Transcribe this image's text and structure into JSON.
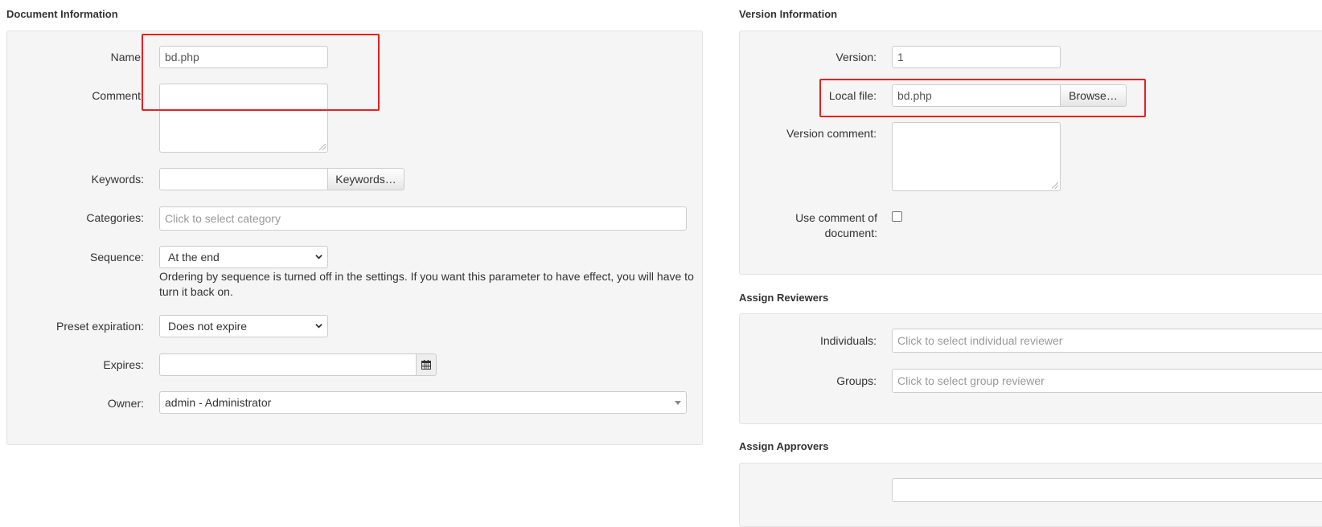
{
  "document_info": {
    "title": "Document Information",
    "name_label": "Name",
    "name_value": "bd.php",
    "comment_label": "Comment",
    "keywords_label": "Keywords:",
    "keywords_button": "Keywords…",
    "categories_label": "Categories:",
    "categories_placeholder": "Click to select category",
    "sequence_label": "Sequence:",
    "sequence_value": "At the end",
    "sequence_help_line1": "Ordering by sequence is turned off in the settings. If you want this parameter to have effect, you will have to",
    "sequence_help_line2": "turn it back on.",
    "preset_label": "Preset expiration:",
    "preset_value": "Does not expire",
    "expires_label": "Expires:",
    "owner_label": "Owner:",
    "owner_value": "admin - Administrator"
  },
  "version_info": {
    "title": "Version Information",
    "version_label": "Version:",
    "version_value": "1",
    "local_file_label": "Local file:",
    "local_file_value": "bd.php",
    "browse_button": "Browse…",
    "version_comment_label": "Version comment:",
    "use_comment_label_line1": "Use comment of",
    "use_comment_label_line2": "document:",
    "use_comment_checked": false
  },
  "reviewers": {
    "title": "Assign Reviewers",
    "individuals_label": "Individuals:",
    "individuals_placeholder": "Click to select individual reviewer",
    "groups_label": "Groups:",
    "groups_placeholder": "Click to select group reviewer"
  },
  "approvers": {
    "title": "Assign Approvers"
  },
  "colors": {
    "highlight": "#e62222",
    "panel_bg": "#f5f5f5",
    "border": "#cccccc"
  },
  "icons": [
    "calendar-icon",
    "chevron-down-icon",
    "caret-down-icon",
    "resize-grip-icon"
  ]
}
